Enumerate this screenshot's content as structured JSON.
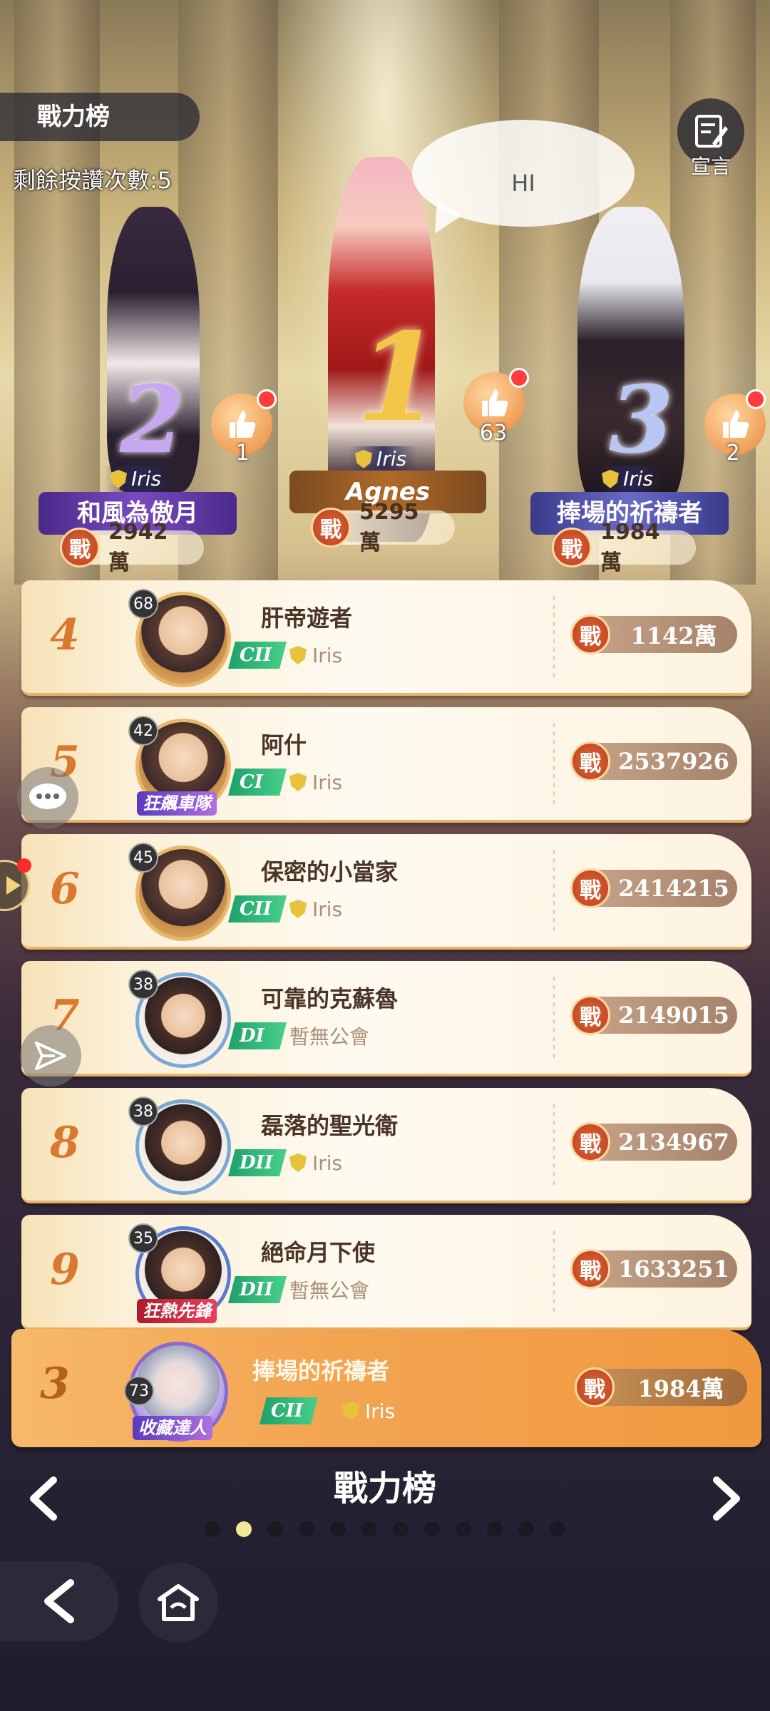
{
  "header": {
    "title": "戰力榜",
    "likes_remaining": "剩餘按讚次數:5",
    "declare_label": "宣言",
    "speech_bubble": "HI"
  },
  "podium": [
    {
      "rank": "2",
      "name": "和風為傲月",
      "guild": "Iris",
      "power": "2942萬",
      "likes": "1"
    },
    {
      "rank": "1",
      "name": "Agnes",
      "guild": "Iris",
      "power": "5295萬",
      "likes": "63"
    },
    {
      "rank": "3",
      "name": "捧場的祈禱者",
      "guild": "Iris",
      "power": "1984萬",
      "likes": "2"
    }
  ],
  "power_glyph": "戰",
  "list": [
    {
      "rank": "4",
      "level": "68",
      "name": "肝帝遊者",
      "grade": "CII",
      "guild": "Iris",
      "power": "1142萬",
      "title": ""
    },
    {
      "rank": "5",
      "level": "42",
      "name": "阿什",
      "grade": "CI",
      "guild": "Iris",
      "power": "2537926",
      "title": "狂飆車隊"
    },
    {
      "rank": "6",
      "level": "45",
      "name": "保密的小當家",
      "grade": "CII",
      "guild": "Iris",
      "power": "2414215",
      "title": ""
    },
    {
      "rank": "7",
      "level": "38",
      "name": "可靠的克蘇魯",
      "grade": "DI",
      "guild": "暫無公會",
      "power": "2149015",
      "title": ""
    },
    {
      "rank": "8",
      "level": "38",
      "name": "磊落的聖光衛",
      "grade": "DII",
      "guild": "Iris",
      "power": "2134967",
      "title": ""
    },
    {
      "rank": "9",
      "level": "35",
      "name": "絕命月下使",
      "grade": "DII",
      "guild": "暫無公會",
      "power": "1633251",
      "title": "狂熱先鋒"
    }
  ],
  "self": {
    "rank": "3",
    "level": "73",
    "name": "捧場的祈禱者",
    "grade": "CII",
    "guild": "Iris",
    "power": "1984萬",
    "title": "收藏達人"
  },
  "footer": {
    "title": "戰力榜",
    "page_count": 12,
    "active_page": 2
  },
  "colors": {
    "accent_orange": "#d9782e",
    "grade_green": "#1ea06a",
    "like_red": "#ff3d3d"
  }
}
